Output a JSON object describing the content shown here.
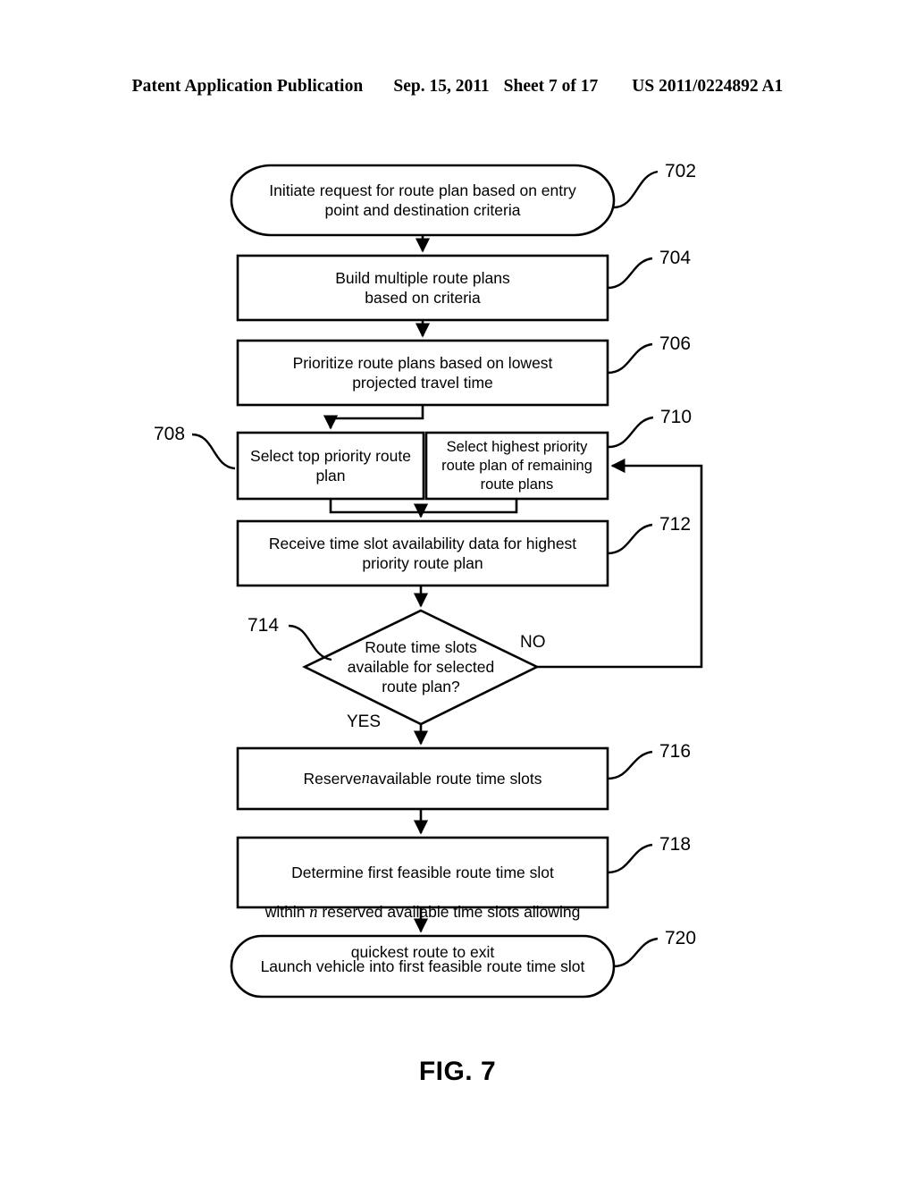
{
  "header": {
    "publication": "Patent Application Publication",
    "date": "Sep. 15, 2011",
    "sheet": "Sheet 7 of 17",
    "patent_number": "US 2011/0224892 A1"
  },
  "figure": {
    "caption": "FIG. 7"
  },
  "nodes": {
    "n702": {
      "ref": "702",
      "text": "Initiate request for route plan based on entry\npoint and destination criteria",
      "shape": "terminator"
    },
    "n704": {
      "ref": "704",
      "text": "Build multiple route plans\nbased on criteria",
      "shape": "process"
    },
    "n706": {
      "ref": "706",
      "text": "Prioritize route plans based on lowest\nprojected travel time",
      "shape": "process"
    },
    "n708": {
      "ref": "708",
      "text": "Select top priority route\nplan",
      "shape": "process"
    },
    "n710": {
      "ref": "710",
      "text": "Select highest priority\nroute plan of remaining\nroute plans",
      "shape": "process"
    },
    "n712": {
      "ref": "712",
      "text": "Receive time slot availability data for highest\npriority route plan",
      "shape": "process"
    },
    "n714": {
      "ref": "714",
      "text": "Route time slots\navailable for selected\nroute plan?",
      "shape": "decision"
    },
    "n716": {
      "ref": "716",
      "text_before": "Reserve ",
      "text_var": "n",
      "text_after": " available route time slots",
      "shape": "process"
    },
    "n718": {
      "ref": "718",
      "line1": "Determine first feasible route time slot",
      "line2_before": "within ",
      "line2_var": "n",
      "line2_after": " reserved available time slots allowing",
      "line3": "quickest route to exit",
      "shape": "process"
    },
    "n720": {
      "ref": "720",
      "text": "Launch vehicle into first feasible route time slot",
      "shape": "terminator"
    }
  },
  "branches": {
    "yes": "YES",
    "no": "NO"
  }
}
